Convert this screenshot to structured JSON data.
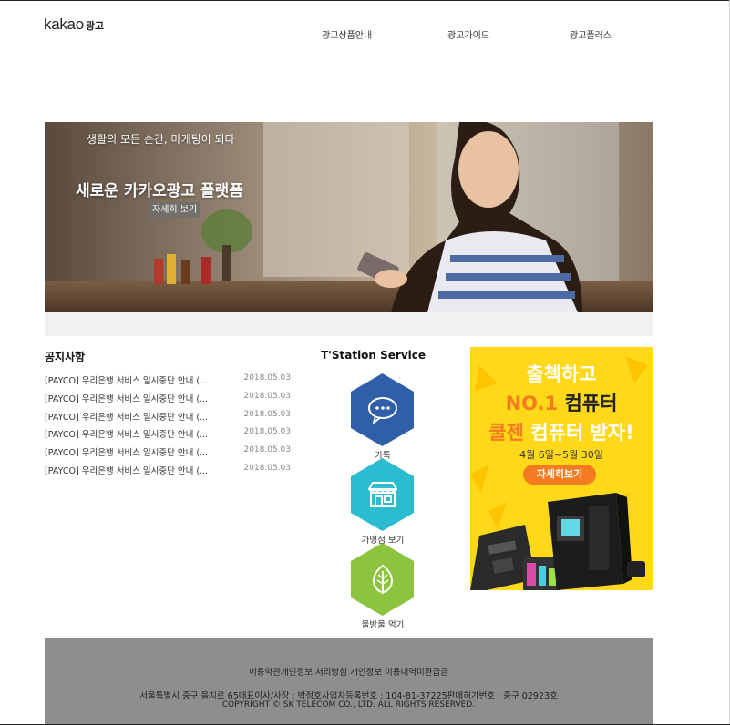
{
  "header": {
    "logo_word": "kakao",
    "logo_sub": "광고",
    "nav": [
      "광고상품안내",
      "광고가이드",
      "광고플러스"
    ]
  },
  "hero": {
    "tagline": "생활의 모든 순간, 마케팅이 되다",
    "title": "새로운 카카오광고 플랫폼",
    "button": "자세히 보기"
  },
  "notice": {
    "title": "공지사항",
    "items": [
      {
        "text": "[PAYCO] 우리은행 서비스 일시중단 안내 (...",
        "date": "2018.05.03"
      },
      {
        "text": "[PAYCO] 우리은행 서비스 일시중단 안내 (...",
        "date": "2018.05.03"
      },
      {
        "text": "[PAYCO] 우리은행 서비스 일시중단 안내 (...",
        "date": "2018.05.03"
      },
      {
        "text": "[PAYCO] 우리은행 서비스 일시중단 안내 (...",
        "date": "2018.05.03"
      },
      {
        "text": "[PAYCO] 우리은행 서비스 일시중단 안내 (...",
        "date": "2018.05.03"
      },
      {
        "text": "[PAYCO] 우리은행 서비스 일시중단 안내 (...",
        "date": "2018.05.03"
      }
    ]
  },
  "service": {
    "title": "T'Station Service",
    "items": [
      {
        "label": "카톡",
        "icon": "chat-bubble-icon",
        "color": "#2f5fa8"
      },
      {
        "label": "가맹점 보기",
        "icon": "store-icon",
        "color": "#2bbccf"
      },
      {
        "label": "울방울 먹기",
        "icon": "leaf-icon",
        "color": "#8cc43f"
      }
    ]
  },
  "ad": {
    "line1": "출첵하고",
    "line2_accent": "NO.1",
    "line2_rest": " 컴퓨터",
    "line3_accent": "쿨젠",
    "line3_rest": " 컴퓨터 받자!",
    "date": "4월 6일~5월 30일",
    "button": "자세히보기",
    "colors": {
      "background": "#ffd81a",
      "accent": "#f47b20",
      "button": "#f47b20"
    }
  },
  "footer": {
    "links": [
      "이용약관",
      "개인정보 처리방침",
      "개인정보 이용내역",
      "미환급금"
    ],
    "address": "서울특별시 중구 을지로 65",
    "ceo": "대표이사/사장 : 박정호",
    "business_no": "사업자등록번호 : 104-81-37225",
    "sales_no": "판매허가번호 : 중구 02923호",
    "copyright": "COPYRIGHT © SK TELECOM CO., LTD. ALL RIGHTS RESERVED."
  }
}
